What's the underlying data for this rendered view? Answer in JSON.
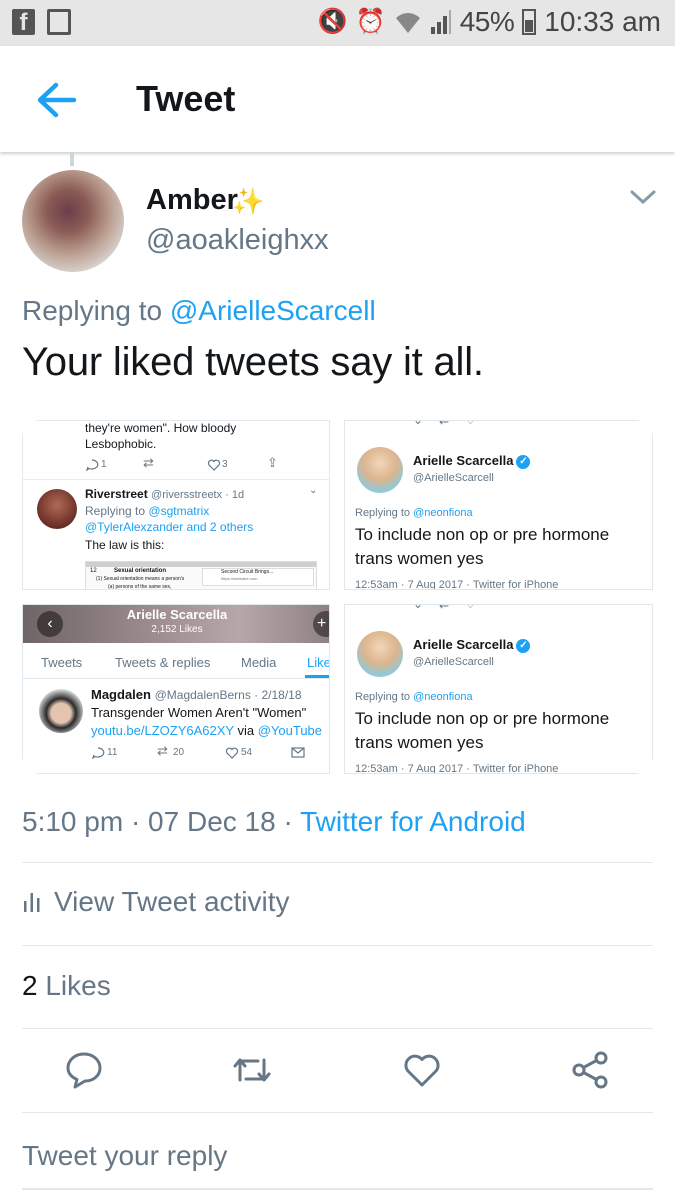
{
  "status_bar": {
    "battery": "45%",
    "time": "10:33 am"
  },
  "header": {
    "title": "Tweet"
  },
  "tweet": {
    "author_name": "Amber",
    "author_handle": "@aoakleighxx",
    "replying_prefix": "Replying to",
    "replying_to": "@ArielleScarcell",
    "text": "Your liked tweets say it all.",
    "timestamp": "5:10 pm · 07 Dec 18 · ",
    "source": "Twitter for Android",
    "activity_label": "View Tweet activity",
    "likes_count": "2",
    "likes_label": "Likes",
    "reply_placeholder": "Tweet your reply"
  },
  "media": {
    "tile1": {
      "top_text_1": "they're women\". How bloody",
      "top_text_2": "Lesbophobic.",
      "reply_count": "1",
      "like_count": "3",
      "name": "Riverstreet",
      "handle_time": "@riversstreetx · 1d",
      "replying_prefix": "Replying to",
      "replying_1": "@sgtmatrix",
      "replying_2": "@TylerAlexzander and 2 others",
      "body": "The law is this:",
      "doc_num": "12",
      "doc_heading": "Sexual orientation",
      "doc_line1": "(1)  Sexual orientation means a person's",
      "doc_line2": "(a)  persons of the same sex,",
      "doc_site": "Second Circuit Brings...",
      "doc_url": "https://workwire.com"
    },
    "tile2": {
      "name": "Arielle Scarcella",
      "handle": "@ArielleScarcell",
      "replying_prefix": "Replying to",
      "replying_to": "@neonfiona",
      "text_1": "To include non op or pre hormone",
      "text_2": "trans women yes",
      "meta": "12:53am · 7 Aug 2017 · Twitter for iPhone"
    },
    "tile3": {
      "profile_name": "Arielle Scarcella",
      "profile_likes": "2,152 Likes",
      "tabs": [
        "Tweets",
        "Tweets & replies",
        "Media",
        "Like"
      ],
      "name": "Magdalen",
      "handle_time": "@MagdalenBerns · 2/18/18",
      "text": "Transgender Women Aren't \"Women\"",
      "link": "youtu.be/LZOZY6A62XY",
      "via": "via",
      "via_handle": "@YouTube",
      "reply_count": "11",
      "retweet_count": "20",
      "like_count": "54"
    },
    "tile4": {
      "name": "Arielle Scarcella",
      "handle": "@ArielleScarcell",
      "replying_prefix": "Replying to",
      "replying_to": "@neonfiona",
      "text_1": "To include non op or pre hormone",
      "text_2": "trans women yes",
      "meta": "12:53am · 7 Aug 2017 · Twitter for iPhone"
    }
  },
  "colors": {
    "accent": "#1da1f2",
    "secondary_text": "#657786",
    "primary_text": "#14171a"
  }
}
